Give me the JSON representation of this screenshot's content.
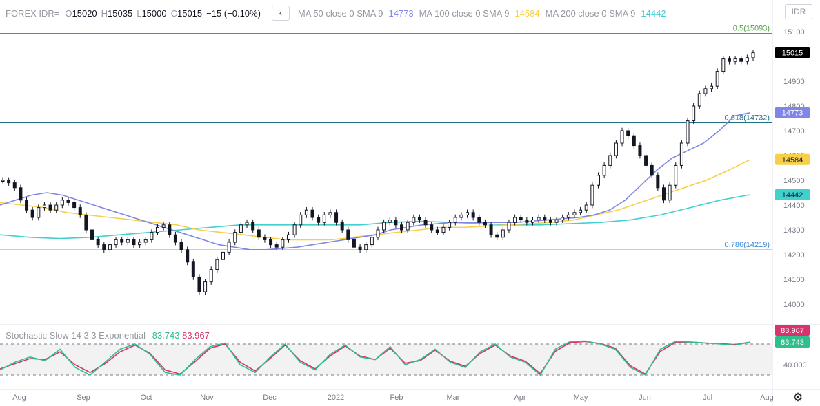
{
  "header": {
    "symbol": "FOREX IDR=",
    "open_key": "O",
    "open": "15020",
    "high_key": "H",
    "high": "15035",
    "low_key": "L",
    "low": "15000",
    "close_key": "C",
    "close": "15015",
    "change": "−15 (−0.10%)",
    "collapse_arrow": "‹",
    "ma50_label": "MA 50 close 0 SMA 9",
    "ma50_value": "14773",
    "ma100_label": "MA 100 close 0 SMA 9",
    "ma100_value": "14584",
    "ma200_label": "MA 200 close 0 SMA 9",
    "ma200_value": "14442"
  },
  "currency_button": "IDR",
  "stochastic": {
    "label": "Stochastic Slow 14 3 3 Exponential",
    "k_value": "83.743",
    "d_value": "83.967",
    "axis_label": "40.000"
  },
  "colors": {
    "ma50": "#7f86e6",
    "ma100": "#f7cf48",
    "ma200": "#40d0cd",
    "fib_top": "#4c9e3e",
    "fib_mid": "#1f6f84",
    "fib_low": "#3a8ad6",
    "k_line": "#2dbf8c",
    "d_line": "#d8336e",
    "price_label": "#000000"
  },
  "icons": {
    "settings": "gear-icon"
  },
  "chart_data": {
    "type": "candlestick",
    "y_ticks": [
      "15100",
      "14900",
      "14800",
      "14700",
      "14600",
      "14500",
      "14400",
      "14300",
      "14200",
      "14100",
      "14000"
    ],
    "ylim": [
      13960,
      15150
    ],
    "x_ticks": [
      "Aug",
      "Sep",
      "Oct",
      "Nov",
      "Dec",
      "2022",
      "Feb",
      "Mar",
      "Apr",
      "May",
      "Jun",
      "Jul",
      "Aug"
    ],
    "fib_levels": [
      {
        "label": "0.5(15093)",
        "value": 15093
      },
      {
        "label": "0.618(14732)",
        "value": 14732
      },
      {
        "label": "0.786(14219)",
        "value": 14219
      }
    ],
    "last_price": {
      "label": "15015",
      "value": 15015
    },
    "ma_labels": [
      {
        "label": "14773",
        "value": 14773
      },
      {
        "label": "14584",
        "value": 14584
      },
      {
        "label": "14442",
        "value": 14442
      }
    ],
    "closes": [
      14500,
      14490,
      14470,
      14420,
      14380,
      14350,
      14390,
      14400,
      14380,
      14400,
      14420,
      14410,
      14390,
      14360,
      14300,
      14260,
      14240,
      14220,
      14240,
      14260,
      14250,
      14260,
      14240,
      14250,
      14260,
      14290,
      14310,
      14320,
      14280,
      14250,
      14220,
      14170,
      14110,
      14050,
      14090,
      14140,
      14180,
      14210,
      14250,
      14290,
      14320,
      14330,
      14300,
      14270,
      14260,
      14240,
      14230,
      14260,
      14280,
      14320,
      14360,
      14380,
      14350,
      14330,
      14360,
      14370,
      14330,
      14300,
      14260,
      14230,
      14220,
      14240,
      14270,
      14300,
      14330,
      14340,
      14320,
      14300,
      14330,
      14350,
      14340,
      14320,
      14300,
      14290,
      14310,
      14330,
      14350,
      14360,
      14370,
      14350,
      14330,
      14320,
      14280,
      14270,
      14300,
      14330,
      14350,
      14340,
      14330,
      14340,
      14350,
      14340,
      14330,
      14340,
      14350,
      14360,
      14370,
      14380,
      14400,
      14480,
      14520,
      14560,
      14600,
      14650,
      14700,
      14680,
      14640,
      14600,
      14560,
      14520,
      14470,
      14420,
      14480,
      14560,
      14650,
      14740,
      14800,
      14850,
      14870,
      14880,
      14940,
      14990,
      14980,
      14990,
      14980,
      14995,
      15015
    ],
    "ma50": [
      14400,
      14420,
      14440,
      14450,
      14440,
      14420,
      14400,
      14380,
      14360,
      14340,
      14320,
      14300,
      14280,
      14260,
      14240,
      14230,
      14220,
      14220,
      14225,
      14230,
      14240,
      14250,
      14260,
      14270,
      14280,
      14300,
      14310,
      14320,
      14325,
      14330,
      14330,
      14330,
      14330,
      14330,
      14335,
      14340,
      14345,
      14350,
      14360,
      14380,
      14420,
      14480,
      14540,
      14590,
      14620,
      14650,
      14700,
      14760,
      14773
    ],
    "ma100": [
      14410,
      14400,
      14390,
      14370,
      14360,
      14350,
      14340,
      14330,
      14320,
      14300,
      14290,
      14280,
      14270,
      14260,
      14260,
      14260,
      14270,
      14280,
      14290,
      14300,
      14310,
      14310,
      14315,
      14320,
      14325,
      14330,
      14340,
      14360,
      14380,
      14410,
      14440,
      14470,
      14500,
      14540,
      14584
    ],
    "ma200": [
      14280,
      14270,
      14265,
      14270,
      14280,
      14290,
      14300,
      14310,
      14320,
      14320,
      14320,
      14320,
      14320,
      14330,
      14335,
      14330,
      14325,
      14320,
      14320,
      14325,
      14330,
      14340,
      14360,
      14390,
      14420,
      14442
    ],
    "stoch_k": [
      30,
      45,
      55,
      48,
      70,
      35,
      20,
      45,
      70,
      80,
      60,
      25,
      20,
      50,
      75,
      82,
      40,
      25,
      55,
      80,
      45,
      30,
      60,
      78,
      55,
      50,
      75,
      40,
      50,
      70,
      45,
      35,
      65,
      80,
      55,
      45,
      20,
      70,
      85,
      86,
      80,
      70,
      35,
      20,
      70,
      85,
      84,
      82,
      80,
      78,
      83.743
    ],
    "stoch_d": [
      32,
      42,
      52,
      50,
      65,
      40,
      25,
      42,
      65,
      78,
      62,
      30,
      22,
      46,
      72,
      80,
      45,
      28,
      52,
      78,
      48,
      32,
      57,
      76,
      57,
      50,
      72,
      43,
      48,
      68,
      47,
      37,
      62,
      78,
      57,
      47,
      23,
      66,
      83,
      85,
      81,
      72,
      38,
      22,
      66,
      83,
      84,
      82,
      81,
      79,
      83.967
    ]
  }
}
